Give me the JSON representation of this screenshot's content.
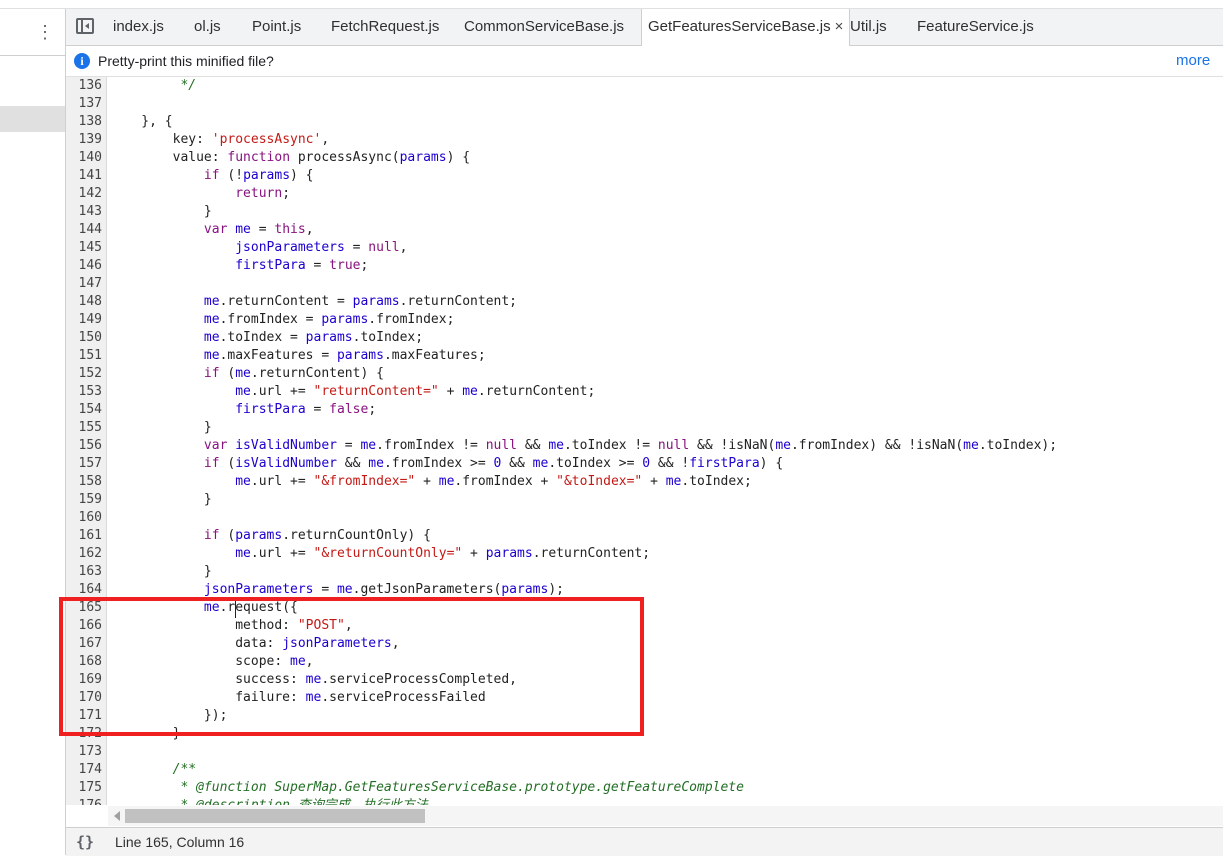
{
  "tabs": [
    {
      "label": "index.js",
      "active": false
    },
    {
      "label": "ol.js",
      "active": false
    },
    {
      "label": "Point.js",
      "active": false
    },
    {
      "label": "FetchRequest.js",
      "active": false
    },
    {
      "label": "CommonServiceBase.js",
      "active": false
    },
    {
      "label": "GetFeaturesServiceBase.js",
      "active": true
    },
    {
      "label": "Util.js",
      "active": false
    },
    {
      "label": "FeatureService.js",
      "active": false
    }
  ],
  "close_glyph": "×",
  "infobar": {
    "text": "Pretty-print this minified file?",
    "link": "more"
  },
  "status": {
    "braces": "{}",
    "position": "Line 165, Column 16"
  },
  "highlight_color": "#f02020",
  "code": {
    "first_line": 136,
    "lines": [
      [
        {
          "t": "         */",
          "c": "cmt"
        }
      ],
      [],
      [
        {
          "t": "    }, {"
        }
      ],
      [
        {
          "t": "        key: "
        },
        {
          "t": "'processAsync'",
          "c": "str"
        },
        {
          "t": ","
        }
      ],
      [
        {
          "t": "        value: "
        },
        {
          "t": "function",
          "c": "kw"
        },
        {
          "t": " processAsync("
        },
        {
          "t": "params",
          "c": "var"
        },
        {
          "t": ") {"
        }
      ],
      [
        {
          "t": "            "
        },
        {
          "t": "if",
          "c": "kw"
        },
        {
          "t": " (!"
        },
        {
          "t": "params",
          "c": "var"
        },
        {
          "t": ") {"
        }
      ],
      [
        {
          "t": "                "
        },
        {
          "t": "return",
          "c": "kw"
        },
        {
          "t": ";"
        }
      ],
      [
        {
          "t": "            }"
        }
      ],
      [
        {
          "t": "            "
        },
        {
          "t": "var",
          "c": "kw"
        },
        {
          "t": " "
        },
        {
          "t": "me",
          "c": "var"
        },
        {
          "t": " = "
        },
        {
          "t": "this",
          "c": "kw"
        },
        {
          "t": ","
        }
      ],
      [
        {
          "t": "                "
        },
        {
          "t": "jsonParameters",
          "c": "var"
        },
        {
          "t": " = "
        },
        {
          "t": "null",
          "c": "kw"
        },
        {
          "t": ","
        }
      ],
      [
        {
          "t": "                "
        },
        {
          "t": "firstPara",
          "c": "var"
        },
        {
          "t": " = "
        },
        {
          "t": "true",
          "c": "kw"
        },
        {
          "t": ";"
        }
      ],
      [],
      [
        {
          "t": "            "
        },
        {
          "t": "me",
          "c": "var"
        },
        {
          "t": ".returnContent = "
        },
        {
          "t": "params",
          "c": "var"
        },
        {
          "t": ".returnContent;"
        }
      ],
      [
        {
          "t": "            "
        },
        {
          "t": "me",
          "c": "var"
        },
        {
          "t": ".fromIndex = "
        },
        {
          "t": "params",
          "c": "var"
        },
        {
          "t": ".fromIndex;"
        }
      ],
      [
        {
          "t": "            "
        },
        {
          "t": "me",
          "c": "var"
        },
        {
          "t": ".toIndex = "
        },
        {
          "t": "params",
          "c": "var"
        },
        {
          "t": ".toIndex;"
        }
      ],
      [
        {
          "t": "            "
        },
        {
          "t": "me",
          "c": "var"
        },
        {
          "t": ".maxFeatures = "
        },
        {
          "t": "params",
          "c": "var"
        },
        {
          "t": ".maxFeatures;"
        }
      ],
      [
        {
          "t": "            "
        },
        {
          "t": "if",
          "c": "kw"
        },
        {
          "t": " ("
        },
        {
          "t": "me",
          "c": "var"
        },
        {
          "t": ".returnContent) {"
        }
      ],
      [
        {
          "t": "                "
        },
        {
          "t": "me",
          "c": "var"
        },
        {
          "t": ".url += "
        },
        {
          "t": "\"returnContent=\"",
          "c": "str"
        },
        {
          "t": " + "
        },
        {
          "t": "me",
          "c": "var"
        },
        {
          "t": ".returnContent;"
        }
      ],
      [
        {
          "t": "                "
        },
        {
          "t": "firstPara",
          "c": "var"
        },
        {
          "t": " = "
        },
        {
          "t": "false",
          "c": "kw"
        },
        {
          "t": ";"
        }
      ],
      [
        {
          "t": "            }"
        }
      ],
      [
        {
          "t": "            "
        },
        {
          "t": "var",
          "c": "kw"
        },
        {
          "t": " "
        },
        {
          "t": "isValidNumber",
          "c": "var"
        },
        {
          "t": " = "
        },
        {
          "t": "me",
          "c": "var"
        },
        {
          "t": ".fromIndex != "
        },
        {
          "t": "null",
          "c": "kw"
        },
        {
          "t": " && "
        },
        {
          "t": "me",
          "c": "var"
        },
        {
          "t": ".toIndex != "
        },
        {
          "t": "null",
          "c": "kw"
        },
        {
          "t": " && !isNaN("
        },
        {
          "t": "me",
          "c": "var"
        },
        {
          "t": ".fromIndex) && !isNaN("
        },
        {
          "t": "me",
          "c": "var"
        },
        {
          "t": ".toIndex);"
        }
      ],
      [
        {
          "t": "            "
        },
        {
          "t": "if",
          "c": "kw"
        },
        {
          "t": " ("
        },
        {
          "t": "isValidNumber",
          "c": "var"
        },
        {
          "t": " && "
        },
        {
          "t": "me",
          "c": "var"
        },
        {
          "t": ".fromIndex >= "
        },
        {
          "t": "0",
          "c": "var"
        },
        {
          "t": " && "
        },
        {
          "t": "me",
          "c": "var"
        },
        {
          "t": ".toIndex >= "
        },
        {
          "t": "0",
          "c": "var"
        },
        {
          "t": " && !"
        },
        {
          "t": "firstPara",
          "c": "var"
        },
        {
          "t": ") {"
        }
      ],
      [
        {
          "t": "                "
        },
        {
          "t": "me",
          "c": "var"
        },
        {
          "t": ".url += "
        },
        {
          "t": "\"&fromIndex=\"",
          "c": "str"
        },
        {
          "t": " + "
        },
        {
          "t": "me",
          "c": "var"
        },
        {
          "t": ".fromIndex + "
        },
        {
          "t": "\"&toIndex=\"",
          "c": "str"
        },
        {
          "t": " + "
        },
        {
          "t": "me",
          "c": "var"
        },
        {
          "t": ".toIndex;"
        }
      ],
      [
        {
          "t": "            }"
        }
      ],
      [],
      [
        {
          "t": "            "
        },
        {
          "t": "if",
          "c": "kw"
        },
        {
          "t": " ("
        },
        {
          "t": "params",
          "c": "var"
        },
        {
          "t": ".returnCountOnly) {"
        }
      ],
      [
        {
          "t": "                "
        },
        {
          "t": "me",
          "c": "var"
        },
        {
          "t": ".url += "
        },
        {
          "t": "\"&returnCountOnly=\"",
          "c": "str"
        },
        {
          "t": " + "
        },
        {
          "t": "params",
          "c": "var"
        },
        {
          "t": ".returnContent;"
        }
      ],
      [
        {
          "t": "            }"
        }
      ],
      [
        {
          "t": "            "
        },
        {
          "t": "jsonParameters",
          "c": "var"
        },
        {
          "t": " = "
        },
        {
          "t": "me",
          "c": "var"
        },
        {
          "t": ".getJsonParameters("
        },
        {
          "t": "params",
          "c": "var"
        },
        {
          "t": ");"
        }
      ],
      [
        {
          "t": "            "
        },
        {
          "t": "me",
          "c": "var"
        },
        {
          "t": ".request({"
        }
      ],
      [
        {
          "t": "                method: "
        },
        {
          "t": "\"POST\"",
          "c": "str"
        },
        {
          "t": ","
        }
      ],
      [
        {
          "t": "                data: "
        },
        {
          "t": "jsonParameters",
          "c": "var"
        },
        {
          "t": ","
        }
      ],
      [
        {
          "t": "                scope: "
        },
        {
          "t": "me",
          "c": "var"
        },
        {
          "t": ","
        }
      ],
      [
        {
          "t": "                success: "
        },
        {
          "t": "me",
          "c": "var"
        },
        {
          "t": ".serviceProcessCompleted,"
        }
      ],
      [
        {
          "t": "                failure: "
        },
        {
          "t": "me",
          "c": "var"
        },
        {
          "t": ".serviceProcessFailed"
        }
      ],
      [
        {
          "t": "            });"
        }
      ],
      [
        {
          "t": "        }"
        }
      ],
      [],
      [
        {
          "t": "        /**",
          "c": "cmt"
        }
      ],
      [
        {
          "t": "         * @function SuperMap.GetFeaturesServiceBase.prototype.getFeatureComplete",
          "c": "cmt"
        }
      ],
      [
        {
          "t": "         * @description 查询完成，执行此方法。",
          "c": "cmt"
        }
      ]
    ]
  }
}
